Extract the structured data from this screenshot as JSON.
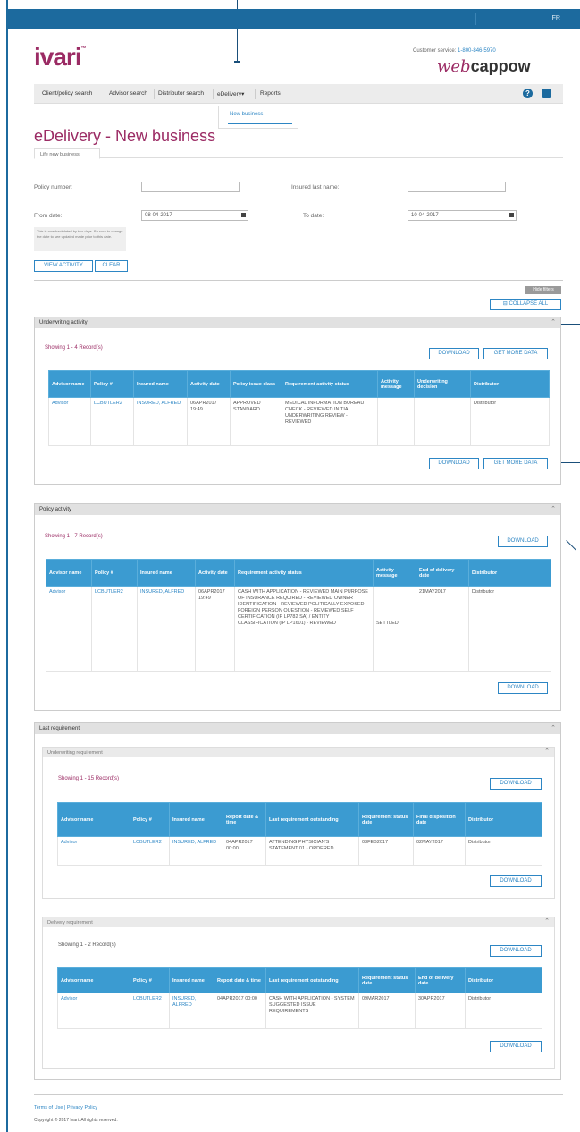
{
  "header": {
    "lang": "FR",
    "logo": "ivari",
    "logo_tm": "™",
    "customer_service_label": "Customer service:",
    "customer_service_phone": "1-800-846-5970",
    "webcappow_web": "web",
    "webcappow_cappow": "cappow"
  },
  "nav": {
    "items": [
      "Client/policy search",
      "Advisor search",
      "Distributor search",
      "eDelivery",
      "Reports"
    ],
    "dropdown_caret": "▾",
    "help_glyph": "?",
    "dropdown_item": "New business"
  },
  "page": {
    "title": "eDelivery - New business",
    "tab": "Life new business"
  },
  "filters": {
    "policy_number_label": "Policy number:",
    "policy_number_value": "",
    "insured_last_name_label": "Insured last name:",
    "insured_last_name_value": "",
    "from_date_label": "From date:",
    "from_date_value": "08-04-2017",
    "to_date_label": "To date:",
    "to_date_value": "10-04-2017",
    "note": "This is now backdated by two days. Be sure to change the date to see updated made prior to this date.",
    "view_activity": "VIEW ACTIVITY",
    "clear": "CLEAR",
    "hide_filters": "Hide filters",
    "collapse_all": "⊟ COLLAPSE ALL"
  },
  "underwriting": {
    "title": "Underwriting activity",
    "caret": "⌃",
    "showing": "Showing 1 - 4 Record(s)",
    "download": "DOWNLOAD",
    "get_more": "GET MORE DATA",
    "headers": [
      "Advisor name",
      "Policy #",
      "Insured name",
      "Activity date",
      "Policy issue class",
      "Requirement activity status",
      "Activity message",
      "Underwriting decision",
      "Distributor"
    ],
    "row": [
      "Advisor",
      "LCBUTLER2",
      "INSURED, ALFRED",
      "06APR2017 19:49",
      "APPROVED STANDARD",
      "MEDICAL INFORMATION BUREAU CHECK - REVIEWED INITIAL UNDERWRITING REVIEW - REVIEWED",
      "",
      "",
      "Distributor"
    ]
  },
  "policy": {
    "title": "Policy activity",
    "caret": "⌃",
    "showing": "Showing 1 - 7 Record(s)",
    "download": "DOWNLOAD",
    "headers": [
      "Advisor name",
      "Policy #",
      "Insured name",
      "Activity date",
      "Requirement activity status",
      "Activity message",
      "End of delivery date",
      "Distributor"
    ],
    "row": [
      "Advisor",
      "LCBUTLER2",
      "INSURED, ALFRED",
      "06APR2017 19:49",
      "CASH WITH APPLICATION - REVIEWED MAIN PURPOSE OF INSURANCE REQUIRED - REVIEWED OWNER IDENTIFICATION - REVIEWED POLITICALLY EXPOSED FOREIGN PERSON QUESTION - REVIEWED SELF CERTIFICATION (IP LP782 SA) / ENTITY CLASSIFICATION (IP LP1601) - REVIEWED",
      "SETTLED",
      "21MAY2017",
      "Distributor"
    ]
  },
  "last_requirement": {
    "title": "Last requirement",
    "caret": "⌃",
    "uw_req": {
      "title": "Underwriting requirement",
      "caret": "⌃",
      "showing": "Showing 1 - 15 Record(s)",
      "download": "DOWNLOAD",
      "headers": [
        "Advisor name",
        "Policy #",
        "Insured name",
        "Report date & time",
        "Last requirement outstanding",
        "Requirement status date",
        "Final disposition date",
        "Distributor"
      ],
      "row": [
        "Advisor",
        "LCBUTLER2",
        "INSURED, ALFRED",
        "04APR2017 00:00",
        "ATTENDING PHYSICIAN'S STATEMENT 01 - ORDERED",
        "03FEB2017",
        "02MAY2017",
        "Distributor"
      ]
    },
    "del_req": {
      "title": "Delivery requirement",
      "caret": "⌃",
      "showing": "Showing 1 - 2 Record(s)",
      "download": "DOWNLOAD",
      "headers": [
        "Advisor name",
        "Policy #",
        "Insured name",
        "Report date & time",
        "Last requirement outstanding",
        "Requirement status date",
        "End of delivery date",
        "Distributor"
      ],
      "row": [
        "Advisor",
        "LCBUTLER2",
        "INSURED, ALFRED",
        "04APR2017 00:00",
        "CASH WITH APPLICATION - SYSTEM SUGGESTED ISSUE REQUIREMENTS",
        "09MAR2017",
        "30APR2017",
        "Distributor"
      ]
    }
  },
  "footer": {
    "links": "Terms of Use | Privacy Policy",
    "copyright": "Copyright © 2017 Ivari. All rights reserved."
  }
}
